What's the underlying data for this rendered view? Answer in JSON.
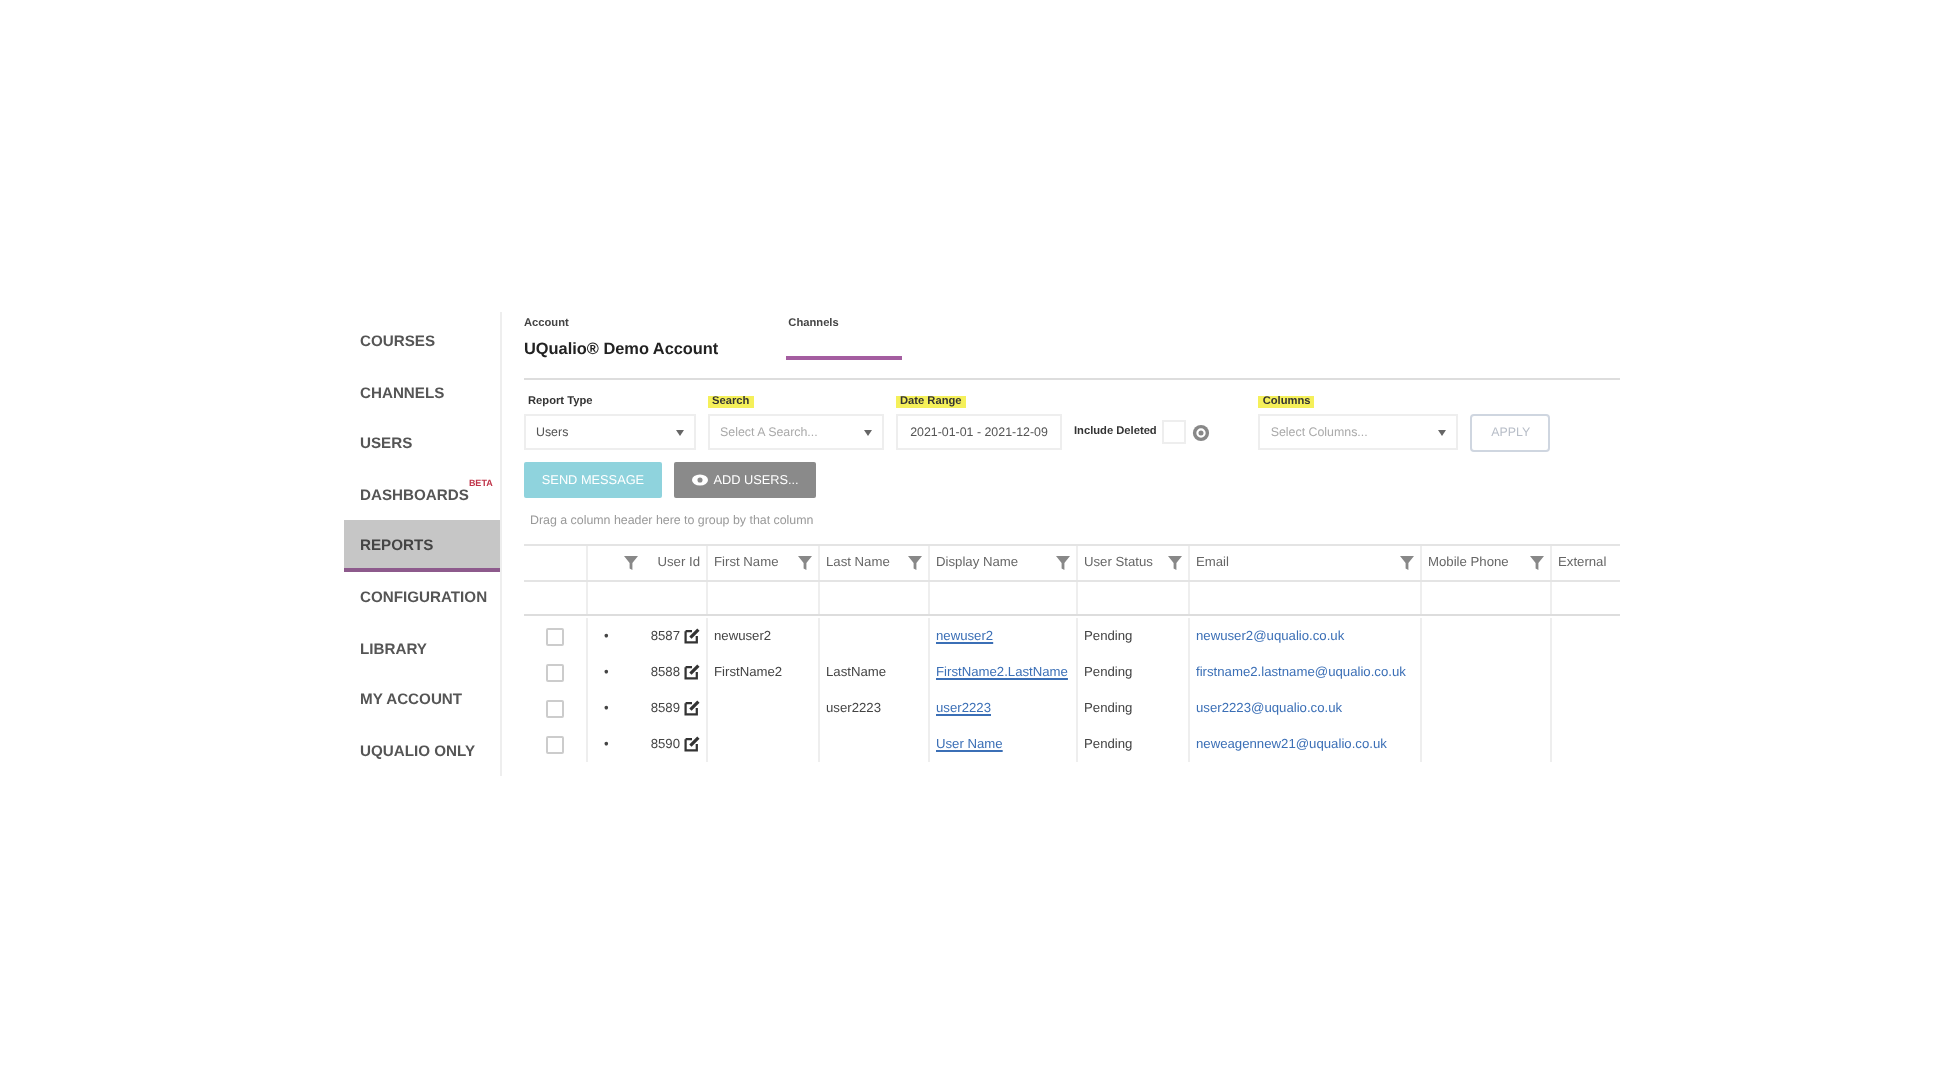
{
  "sidebar": {
    "items": [
      {
        "label": "COURSES",
        "selected": false
      },
      {
        "label": "CHANNELS",
        "selected": false
      },
      {
        "label": "USERS",
        "selected": false
      },
      {
        "label": "DASHBOARDS",
        "badge": "BETA",
        "selected": false
      },
      {
        "label": "REPORTS",
        "selected": true
      },
      {
        "label": "CONFIGURATION",
        "selected": false
      },
      {
        "label": "LIBRARY",
        "selected": false
      },
      {
        "label": "MY ACCOUNT",
        "selected": false
      },
      {
        "label": "UQUALIO ONLY",
        "selected": false
      }
    ]
  },
  "header": {
    "account_label": "Account",
    "account_name": "UQualio® Demo Account",
    "tabs": [
      {
        "label": "Channels",
        "selected": true
      }
    ]
  },
  "filters": [
    {
      "kind": "select",
      "label": "Report Type",
      "value": "Users",
      "highlighted": false
    },
    {
      "kind": "select",
      "label": "Search",
      "placeholder": "Select A Search...",
      "highlighted": true
    },
    {
      "kind": "date",
      "label": "Date Range",
      "value": "2021-01-01 - 2021-12-09",
      "highlighted": true
    },
    {
      "kind": "checkbox",
      "label": "Include Deleted",
      "checked": false
    },
    {
      "kind": "select",
      "label": "Columns",
      "placeholder": "Select Columns...",
      "highlighted": true
    },
    {
      "kind": "button",
      "label": "APPLY"
    }
  ],
  "actions": [
    {
      "label": "SEND MESSAGE",
      "kind": "primary"
    },
    {
      "label": "ADD USERS...",
      "kind": "secondary"
    }
  ],
  "group_hint": "Drag a column header here to group by that column",
  "table": {
    "columns": [
      {
        "label": "User Id",
        "filterable": true
      },
      {
        "label": "First Name",
        "filterable": true
      },
      {
        "label": "Last Name",
        "filterable": true
      },
      {
        "label": "Display Name",
        "filterable": true
      },
      {
        "label": "User Status",
        "filterable": true
      },
      {
        "label": "Email",
        "filterable": true
      },
      {
        "label": "Mobile Phone",
        "filterable": true
      },
      {
        "label": "External",
        "filterable": false
      }
    ],
    "rows": [
      {
        "checked": false,
        "marker": "•",
        "user_id": "8587",
        "first_name": "newuser2",
        "last_name": "",
        "display_name": "newuser2",
        "status": "Pending",
        "email": "newuser2@uqualio.co.uk"
      },
      {
        "checked": false,
        "marker": "•",
        "user_id": "8588",
        "first_name": "FirstName2",
        "last_name": "LastName",
        "display_name": "FirstName2.LastName",
        "status": "Pending",
        "email": "firstname2.lastname@uqualio.co.uk"
      },
      {
        "checked": false,
        "marker": "•",
        "user_id": "8589",
        "first_name": "",
        "last_name": "user2223",
        "display_name": "user2223",
        "status": "Pending",
        "email": "user2223@uqualio.co.uk"
      },
      {
        "checked": false,
        "marker": "•",
        "user_id": "8590",
        "first_name": "",
        "last_name": "",
        "display_name": "User Name",
        "status": "Pending",
        "email": "neweagennew21@uqualio.co.uk"
      }
    ]
  }
}
